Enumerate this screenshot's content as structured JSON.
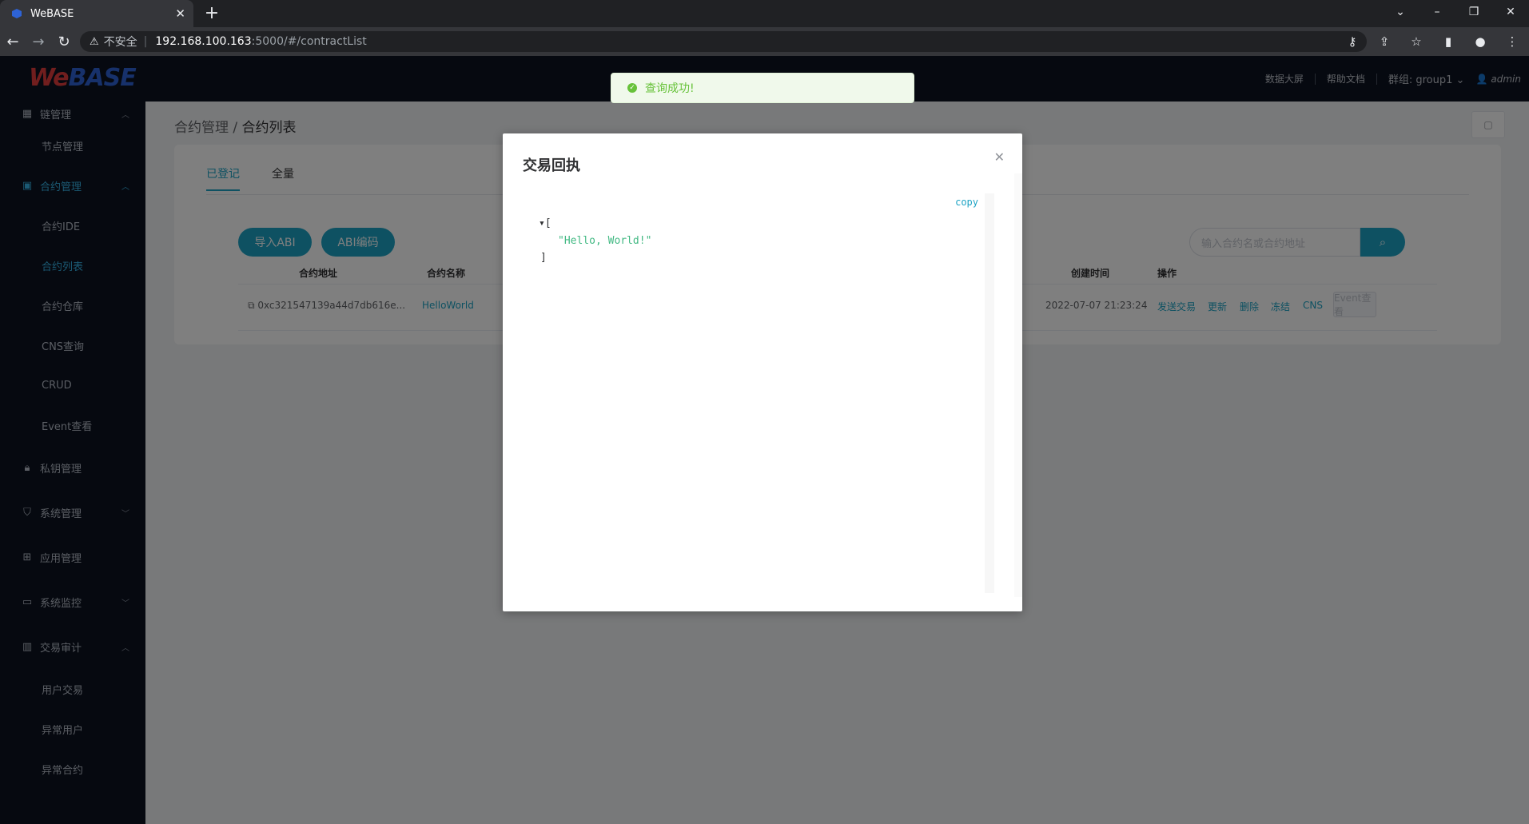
{
  "browser": {
    "tab_title": "WeBASE",
    "url_warning": "不安全",
    "url_host": "192.168.100.163",
    "url_path": ":5000/#/contractList"
  },
  "header": {
    "logo_we": "We",
    "logo_base": "BASE",
    "data_screen": "数据大屏",
    "help_docs": "帮助文档",
    "group": "群组: group1",
    "user": "admin"
  },
  "toast": {
    "message": "查询成功!"
  },
  "sidebar": {
    "chain_mgmt": "链管理",
    "node_mgmt": "节点管理",
    "contract_mgmt": "合约管理",
    "contract_ide": "合约IDE",
    "contract_list": "合约列表",
    "contract_repo": "合约仓库",
    "cns_query": "CNS查询",
    "crud": "CRUD",
    "event_view": "Event查看",
    "key_mgmt": "私钥管理",
    "sys_mgmt": "系统管理",
    "app_mgmt": "应用管理",
    "sys_monitor": "系统监控",
    "tx_audit": "交易审计",
    "user_tx": "用户交易",
    "abnormal_user": "异常用户",
    "abnormal_contract": "异常合约"
  },
  "main": {
    "breadcrumb_parent": "合约管理",
    "breadcrumb_sep": "/",
    "breadcrumb_current": "合约列表",
    "tabs": [
      "已登记",
      "全量"
    ],
    "import_abi": "导入ABI",
    "abi_encode": "ABI编码",
    "search_placeholder": "输入合约名或合约地址",
    "columns": {
      "address": "合约地址",
      "name": "合约名称",
      "created": "创建时间",
      "ops": "操作"
    },
    "row": {
      "address": "0xc321547139a44d7db616e...",
      "name": "HelloWorld",
      "created": "2022-07-07 21:23:24",
      "ops": [
        "发送交易",
        "更新",
        "删除",
        "冻结",
        "CNS",
        "Event查看"
      ]
    }
  },
  "dialog": {
    "title": "交易回执",
    "copy": "copy",
    "json_open": "[",
    "json_value": "\"Hello, World!\"",
    "json_close": "]"
  },
  "colors": {
    "accent": "#1da3c4",
    "sidebar_bg": "#0c1220",
    "success": "#67c23a"
  }
}
